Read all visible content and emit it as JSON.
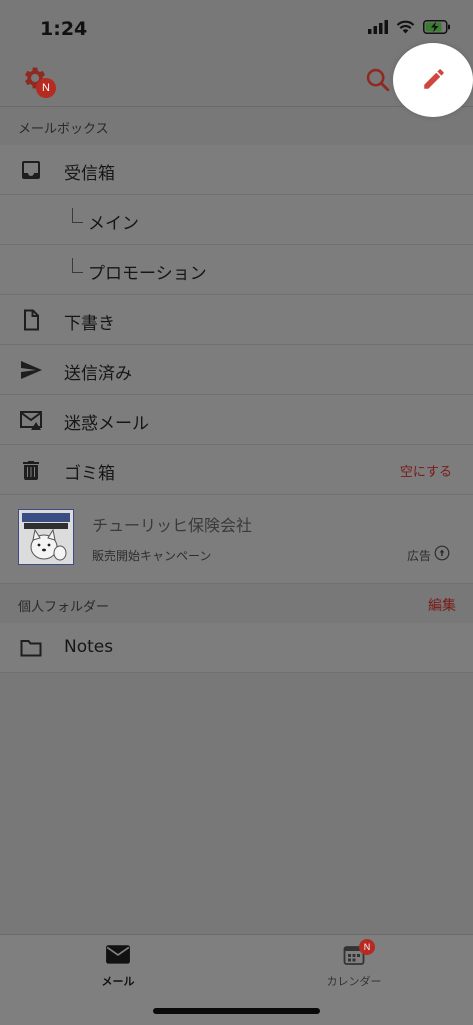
{
  "status_bar": {
    "time": "1:24"
  },
  "nav": {
    "settings_badge": "N",
    "icons": [
      "gear-icon",
      "search-icon",
      "pencil-icon"
    ]
  },
  "mailboxes": {
    "header": "メールボックス",
    "items": [
      {
        "label": "受信箱",
        "icon": "inbox-icon"
      },
      {
        "label": "メイン",
        "icon": ""
      },
      {
        "label": "プロモーション",
        "icon": ""
      },
      {
        "label": "下書き",
        "icon": "document-icon"
      },
      {
        "label": "送信済み",
        "icon": "send-icon"
      },
      {
        "label": "迷惑メール",
        "icon": "spam-icon"
      },
      {
        "label": "ゴミ箱",
        "icon": "trash-icon",
        "action": "空にする"
      }
    ]
  },
  "ad": {
    "title": "チューリッヒ保険会社",
    "subtitle": "販売開始キャンペーン",
    "label": "広告"
  },
  "personal": {
    "header": "個人フォルダー",
    "action": "編集",
    "items": [
      {
        "label": "Notes",
        "icon": "folder-icon"
      }
    ]
  },
  "tabs": {
    "mail": "メール",
    "calendar": "カレンダー",
    "calendar_badge": "N"
  },
  "colors": {
    "accent": "#b52a21",
    "overlay_bg": "#787878"
  }
}
